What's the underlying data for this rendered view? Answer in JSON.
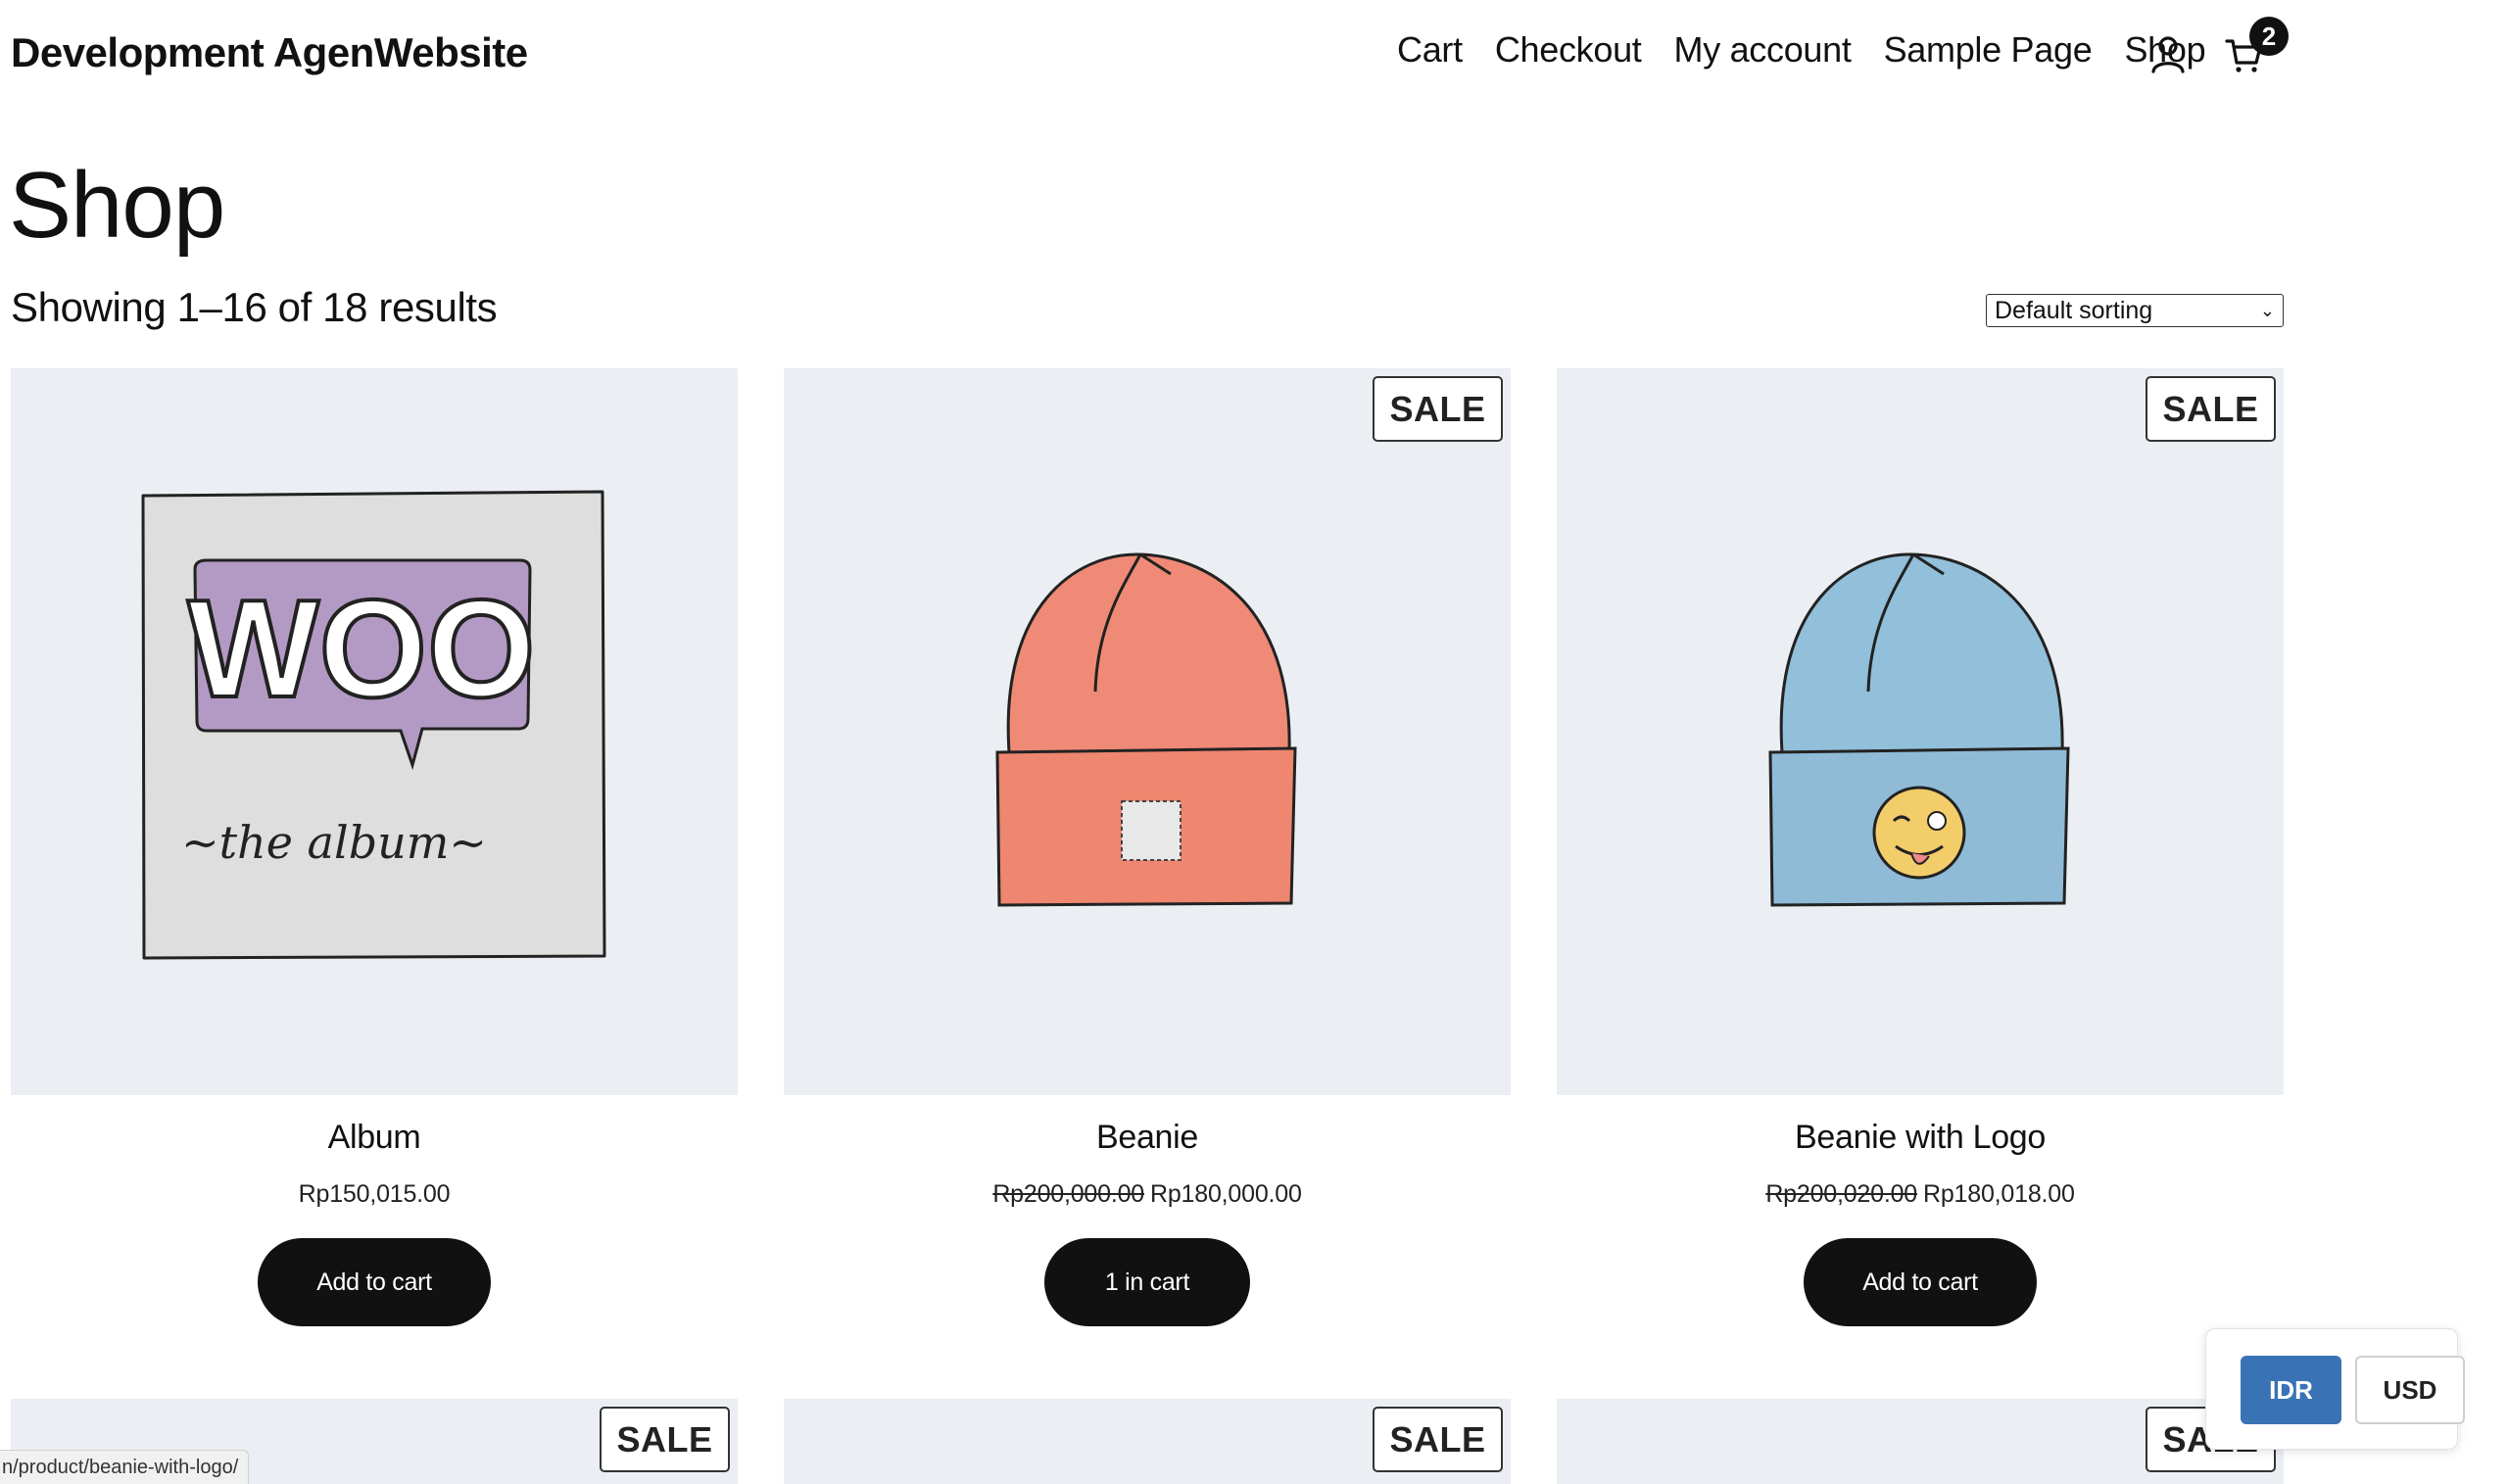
{
  "site": {
    "title": "Development AgenWebsite"
  },
  "nav": {
    "items": [
      "Cart",
      "Checkout",
      "My account",
      "Sample Page",
      "Shop"
    ]
  },
  "cart": {
    "count": "2"
  },
  "page": {
    "title": "Shop",
    "result_count": "Showing 1–16 of 18 results",
    "sorting": "Default sorting"
  },
  "products": [
    {
      "name": "Album",
      "price": "Rp150,015.00",
      "old_price": "",
      "button": "Add to cart",
      "sale_badge": ""
    },
    {
      "name": "Beanie",
      "price": "Rp180,000.00",
      "old_price": "Rp200,000.00",
      "button": "1 in cart",
      "sale_badge": "SALE"
    },
    {
      "name": "Beanie with Logo",
      "price": "Rp180,018.00",
      "old_price": "Rp200,020.00",
      "button": "Add to cart",
      "sale_badge": "SALE"
    }
  ],
  "row2": {
    "badges": [
      "SALE",
      "SALE",
      "SALE"
    ]
  },
  "currency": {
    "options": [
      "IDR",
      "USD"
    ],
    "selected": "IDR",
    "accent": "#3a73b5"
  },
  "status": {
    "url": "n/product/beanie-with-logo/"
  }
}
